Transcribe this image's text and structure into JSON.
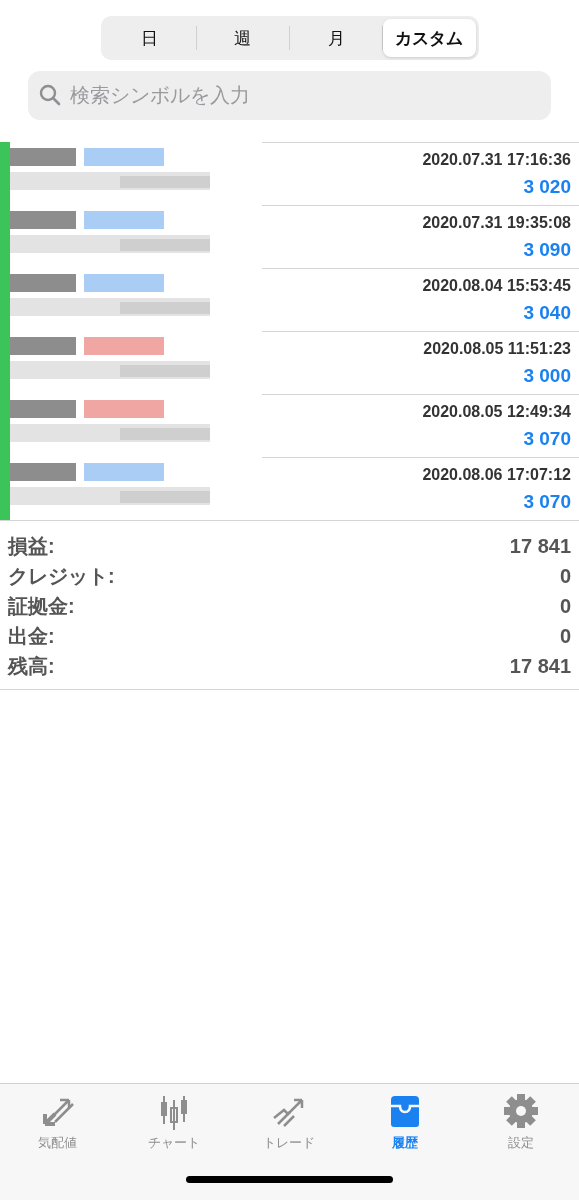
{
  "periods": [
    {
      "label": "日",
      "selected": false
    },
    {
      "label": "週",
      "selected": false
    },
    {
      "label": "月",
      "selected": false
    },
    {
      "label": "カスタム",
      "selected": true
    }
  ],
  "search": {
    "placeholder": "検索シンボルを入力"
  },
  "deals": [
    {
      "time": "2020.07.31 17:16:36",
      "amount": "3 020",
      "color": "#a9cdf5"
    },
    {
      "time": "2020.07.31 19:35:08",
      "amount": "3 090",
      "color": "#a9cdf5"
    },
    {
      "time": "2020.08.04 15:53:45",
      "amount": "3 040",
      "color": "#a9cdf5"
    },
    {
      "time": "2020.08.05 11:51:23",
      "amount": "3 000",
      "color": "#f0a7a4"
    },
    {
      "time": "2020.08.05 12:49:34",
      "amount": "3 070",
      "color": "#f0a7a4"
    },
    {
      "time": "2020.08.06 17:07:12",
      "amount": "3 070",
      "color": "#a9cdf5"
    }
  ],
  "summary": [
    {
      "label": "損益:",
      "value": "17 841"
    },
    {
      "label": "クレジット:",
      "value": "0"
    },
    {
      "label": "証拠金:",
      "value": "0"
    },
    {
      "label": "出金:",
      "value": "0"
    },
    {
      "label": "残高:",
      "value": "17 841"
    }
  ],
  "tabbar": [
    {
      "kind": "quotes",
      "label": "気配値",
      "selected": false
    },
    {
      "kind": "chart",
      "label": "チャート",
      "selected": false
    },
    {
      "kind": "trade",
      "label": "トレード",
      "selected": false
    },
    {
      "kind": "history",
      "label": "履歴",
      "selected": true
    },
    {
      "kind": "settings",
      "label": "設定",
      "selected": false
    }
  ]
}
